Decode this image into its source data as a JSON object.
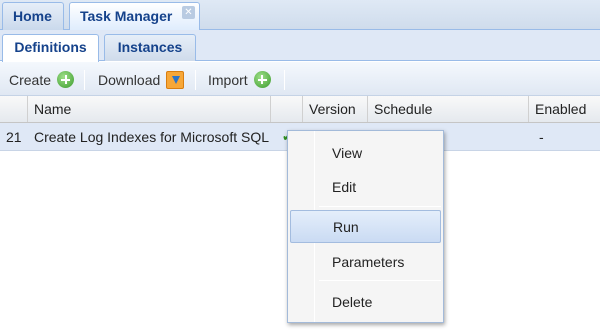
{
  "top_tabs": [
    {
      "label": "Home"
    },
    {
      "label": "Task Manager"
    }
  ],
  "sub_tabs": [
    {
      "label": "Definitions"
    },
    {
      "label": "Instances"
    }
  ],
  "toolbar": {
    "create_label": "Create",
    "download_label": "Download",
    "import_label": "Import"
  },
  "grid": {
    "columns": [
      "Name",
      "Version",
      "Schedule",
      "Enabled"
    ],
    "rows": [
      {
        "num": "21",
        "name": "Create Log Indexes for Microsoft SQL",
        "check": "✔",
        "enabled": "-"
      }
    ]
  },
  "context_menu": {
    "items": [
      "View",
      "Edit",
      "Run",
      "Parameters",
      "Delete"
    ],
    "active": "Run"
  },
  "colors": {
    "tab_text": "#15428b",
    "selected_row": "#dfe8f6",
    "add_icon": "#3a9a2a",
    "download_icon": "#f7a738"
  }
}
